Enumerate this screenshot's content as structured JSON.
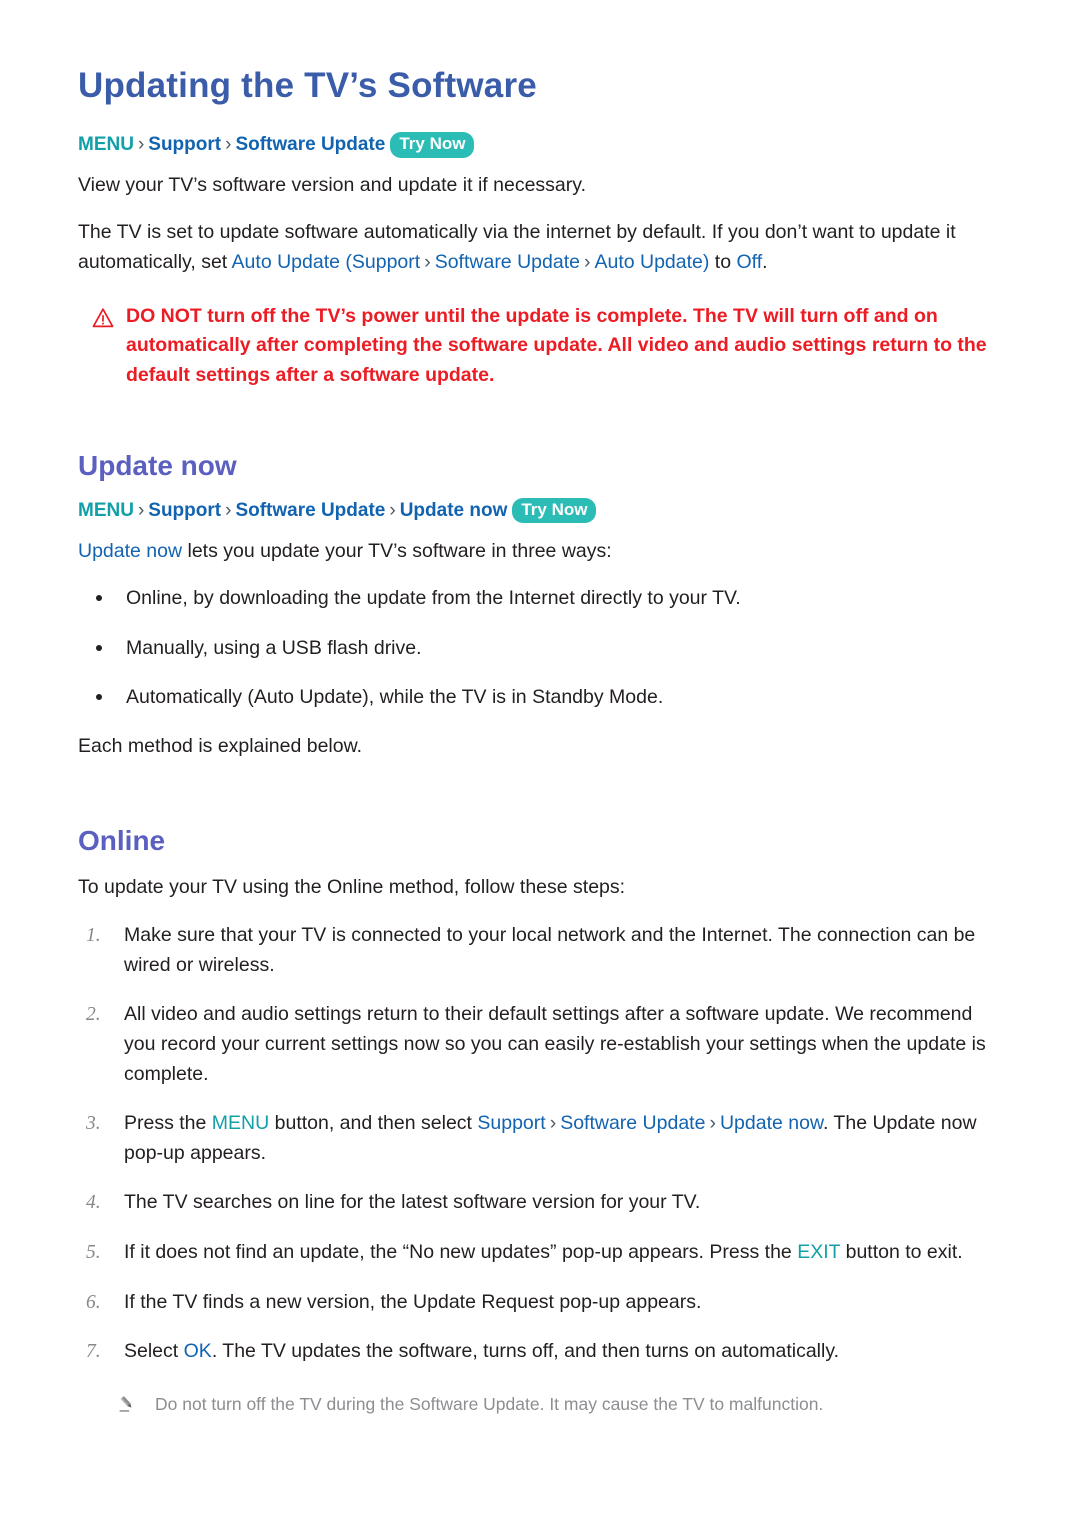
{
  "colors": {
    "title": "#3a5ca9",
    "section_heading": "#5b5fc0",
    "link_blue": "#1263b0",
    "link_teal": "#12a0a8",
    "badge_bg": "#2bbcb5",
    "warning_red": "#ec1c24",
    "note_gray": "#8c8e91",
    "body_text": "#231f20"
  },
  "page_title": "Updating the TV’s Software",
  "breadcrumb_1": {
    "menu": "MENU",
    "sep": "›",
    "support": "Support",
    "software_update": "Software Update",
    "try_now": "Try Now"
  },
  "intro": {
    "line1": "View your TV’s software version and update it if necessary.",
    "line2_a": "The TV is set to update software automatically via the internet by default. If you don’t want to update it automatically, set ",
    "line2_auto_update": "Auto Update",
    "line2_paren_open": " (",
    "line2_support": "Support",
    "line2_sep1": "›",
    "line2_software_update": "Software Update",
    "line2_sep2": "›",
    "line2_auto_update2": "Auto Update",
    "line2_paren_close": ")",
    "line2_to": " to ",
    "line2_off": "Off",
    "line2_end": "."
  },
  "warning": {
    "icon": "warning-triangle-icon",
    "text": "DO NOT turn off the TV’s power until the update is complete. The TV will turn off and on automatically after completing the software update. All video and audio settings return to the default settings after a software update."
  },
  "update_now": {
    "heading": "Update now",
    "breadcrumb": {
      "menu": "MENU",
      "sep": "›",
      "support": "Support",
      "software_update": "Software Update",
      "update_now": "Update now",
      "try_now": "Try Now"
    },
    "intro_link": "Update now",
    "intro_rest": " lets you update your TV’s software in three ways:",
    "bullets": [
      "Online, by downloading the update from the Internet directly to your TV.",
      "Manually, using a USB flash drive.",
      "Automatically (Auto Update), while the TV is in Standby Mode."
    ],
    "closing": "Each method is explained below."
  },
  "online": {
    "heading": "Online",
    "intro": "To update your TV using the Online method, follow these steps:",
    "steps": [
      {
        "num": "1.",
        "text": "Make sure that your TV is connected to your local network and the Internet. The connection can be wired or wireless."
      },
      {
        "num": "2.",
        "text": "All video and audio settings return to their default settings after a software update. We recommend you record your current settings now so you can easily re-establish your settings when the update is complete."
      },
      {
        "num": "3.",
        "text": ""
      },
      {
        "num": "4.",
        "text": "The TV searches on line for the latest software version for your TV."
      },
      {
        "num": "5.",
        "text": ""
      },
      {
        "num": "6.",
        "text": "If the TV finds a new version, the Update Request pop-up appears."
      },
      {
        "num": "7.",
        "text": ""
      }
    ],
    "step3": {
      "a": "Press the ",
      "menu": "MENU",
      "b": " button, and then select ",
      "support": "Support",
      "sep1": "›",
      "software_update": "Software Update",
      "sep2": "›",
      "update_now": "Update now",
      "c": ". The Update now pop-up appears."
    },
    "step5": {
      "a": "If it does not find an update, the “No new updates” pop-up appears. Press the ",
      "exit": "EXIT",
      "b": " button to exit."
    },
    "step7": {
      "a": "Select ",
      "ok": "OK",
      "b": ". The TV updates the software, turns off, and then turns on automatically."
    },
    "note": {
      "icon": "pencil-icon",
      "text": "Do not turn off the TV during the Software Update. It may cause the TV to malfunction."
    }
  }
}
